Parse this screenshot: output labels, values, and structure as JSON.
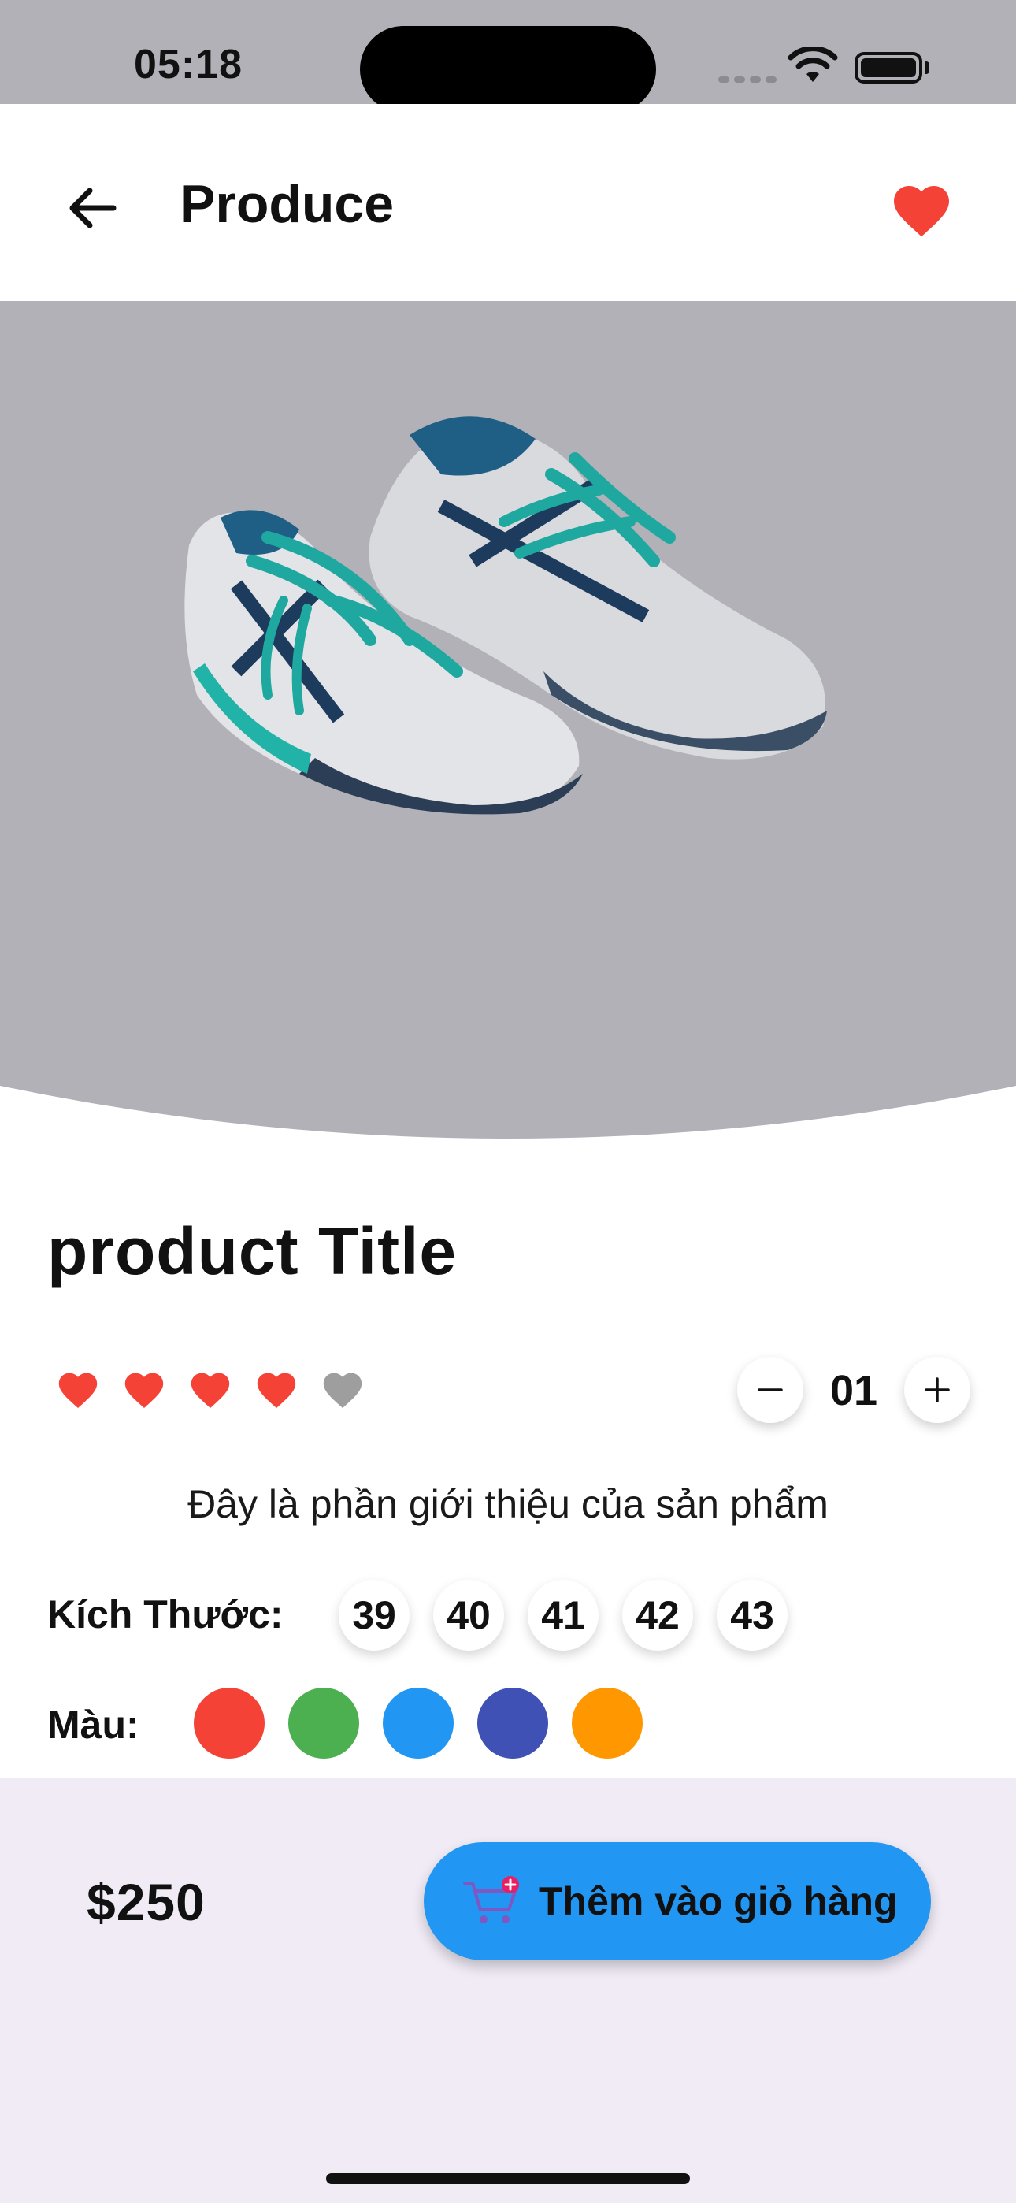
{
  "status_bar": {
    "time": "05:18"
  },
  "app_bar": {
    "back_icon": "arrow-left-icon",
    "title": "Produce",
    "favorite_icon": "heart-icon",
    "favorite_color": "#f44336"
  },
  "hero": {
    "image": "running-sneakers-pair",
    "background": "#b2b1b8"
  },
  "product": {
    "title": "product Title",
    "rating": {
      "value": 4,
      "max": 5,
      "filled_color": "#f44336",
      "empty_color": "#9e9e9e"
    },
    "quantity": {
      "value": "01",
      "minus_icon": "minus-icon",
      "plus_icon": "plus-icon"
    },
    "description": "Đây là phần giới thiệu của sản phẩm",
    "size_label": "Kích Thước:",
    "sizes": [
      "39",
      "40",
      "41",
      "42",
      "43"
    ],
    "color_label": "Màu:",
    "colors": [
      "#f44336",
      "#4caf50",
      "#2196f3",
      "#3f51b5",
      "#ff9800"
    ]
  },
  "bottom_bar": {
    "price": "$250",
    "add_to_cart_label": "Thêm vào giỏ hàng",
    "cart_icon": "add-shopping-cart-icon",
    "button_color": "#2196f3"
  }
}
